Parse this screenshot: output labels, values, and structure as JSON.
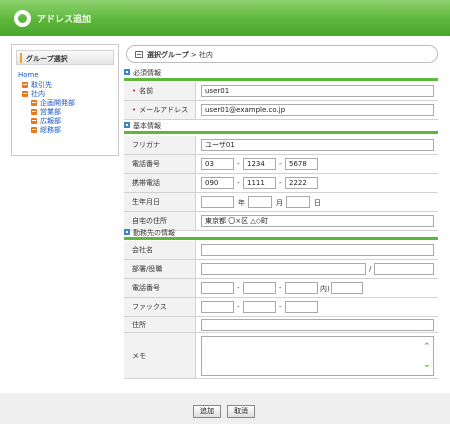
{
  "window": {
    "title": "アドレス追加"
  },
  "sidebar": {
    "heading": "グループ選択",
    "items": [
      {
        "label": "Home"
      },
      {
        "label": "取引先"
      },
      {
        "label": "社内"
      },
      {
        "label": "企画開発部"
      },
      {
        "label": "営業部"
      },
      {
        "label": "広報部"
      },
      {
        "label": "総務部"
      }
    ]
  },
  "breadcrumb": {
    "selected_label": "選択グループ",
    "separator": ">",
    "current": "社内"
  },
  "required": {
    "title": "必須情報",
    "name_label": "名前",
    "name_value": "user01",
    "email_label": "メールアドレス",
    "email_value": "user01@example.co.jp"
  },
  "basic": {
    "title": "基本情報",
    "furigana_label": "フリガナ",
    "furigana_value": "ユーザ01",
    "phone_label": "電話番号",
    "phone": [
      "03",
      "1234",
      "5678"
    ],
    "mobile_label": "携帯電話",
    "mobile": [
      "090",
      "1111",
      "2222"
    ],
    "birthday_label": "生年月日",
    "year_unit": "年",
    "month_unit": "月",
    "day_unit": "日",
    "address_label": "自宅の住所",
    "address_value": "東京都 〇×区 △◇町"
  },
  "work": {
    "title": "勤務先の情報",
    "company_label": "会社名",
    "dept_label": "部署/役職",
    "dept_sep": "/",
    "phone_label": "電話番号",
    "ext_label": "内)",
    "fax_label": "ファックス",
    "address_label": "住所",
    "memo_label": "メモ"
  },
  "dash": "-",
  "required_mark": "•",
  "buttons": {
    "add": "追加",
    "cancel": "取消"
  },
  "colors": {
    "header_green": "#5cb73a",
    "link_blue": "#1a55c4",
    "required_red": "#d2182c"
  }
}
